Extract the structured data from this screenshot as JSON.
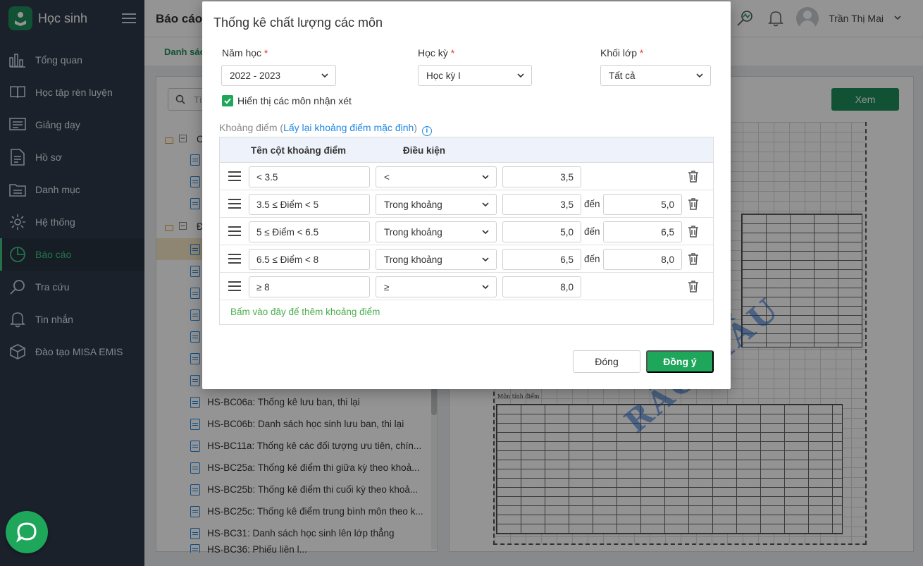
{
  "sidebar": {
    "app_title": "Học sinh",
    "items": [
      {
        "label": "Tổng quan",
        "icon": "bar-chart-icon"
      },
      {
        "label": "Học tập rèn luyện",
        "icon": "book-icon"
      },
      {
        "label": "Giảng dạy",
        "icon": "board-icon"
      },
      {
        "label": "Hồ sơ",
        "icon": "profile-doc-icon"
      },
      {
        "label": "Danh mục",
        "icon": "folder-list-icon"
      },
      {
        "label": "Hệ thống",
        "icon": "gear-icon"
      },
      {
        "label": "Báo cáo",
        "icon": "pie-chart-icon",
        "active": true
      },
      {
        "label": "Tra cứu",
        "icon": "search-icon"
      },
      {
        "label": "Tin nhắn",
        "icon": "bell-icon"
      },
      {
        "label": "Đào tạo MISA EMIS",
        "icon": "cube-icon"
      }
    ]
  },
  "topbar": {
    "title": "Báo cáo",
    "user_name": "Trần Thị Mai"
  },
  "subtabs": {
    "first": "Danh sác"
  },
  "left_panel": {
    "search_placeholder": "Tì",
    "tree_group_1": "C",
    "tree_group_2": "Đ",
    "reports": [
      "HS-BC06a: Thống kê lưu ban, thi lại",
      "HS-BC06b: Danh sách học sinh lưu ban, thi lại",
      "HS-BC11a: Thống kê các đối tượng ưu tiên, chín...",
      "HS-BC25a: Thống kê điểm thi giữa kỳ theo khoả...",
      "HS-BC25b: Thống kê điểm thi cuối kỳ theo khoả...",
      "HS-BC25c: Thống kê điểm trung bình môn theo k...",
      "HS-BC31: Danh sách học sinh lên lớp thẳng",
      "HS-BC36: Phiếu liên l..."
    ]
  },
  "right_panel": {
    "view_button": "Xem",
    "preview_heading": "Môn tính điểm",
    "watermark": "RẢC MẪU"
  },
  "modal": {
    "title": "Thống kê chất lượng các môn",
    "school_year_label": "Năm học",
    "school_year_value": "2022 - 2023",
    "semester_label": "Học kỳ",
    "semester_value": "Học kỳ I",
    "grade_label": "Khối lớp",
    "grade_value": "Tất cả",
    "required_mark": "*",
    "show_comment_subjects": "Hiển thị các môn nhận xét",
    "range_label": "Khoảng điểm (",
    "range_reset_link": "Lấy lại khoảng điểm mặc định",
    "range_label_end": ")",
    "col_name": "Tên cột khoảng điểm",
    "col_condition": "Điều kiện",
    "to_word": "đến",
    "rows": [
      {
        "name": "< 3.5",
        "condition": "<",
        "from": "3,5",
        "to": ""
      },
      {
        "name": "3.5 ≤ Điểm < 5",
        "condition": "Trong khoảng",
        "from": "3,5",
        "to": "5,0"
      },
      {
        "name": "5 ≤ Điểm < 6.5",
        "condition": "Trong khoảng",
        "from": "5,0",
        "to": "6,5"
      },
      {
        "name": "6.5 ≤ Điểm < 8",
        "condition": "Trong khoảng",
        "from": "6,5",
        "to": "8,0"
      },
      {
        "name": "≥ 8",
        "condition": "≥",
        "from": "8,0",
        "to": ""
      }
    ],
    "add_range_link": "Bấm vào đây để thêm khoảng điểm",
    "close_button": "Đóng",
    "ok_button": "Đồng ý"
  },
  "colors": {
    "accent": "#1ea65a",
    "sidebar_bg": "#2e3a4b",
    "link": "#1e88e5"
  }
}
